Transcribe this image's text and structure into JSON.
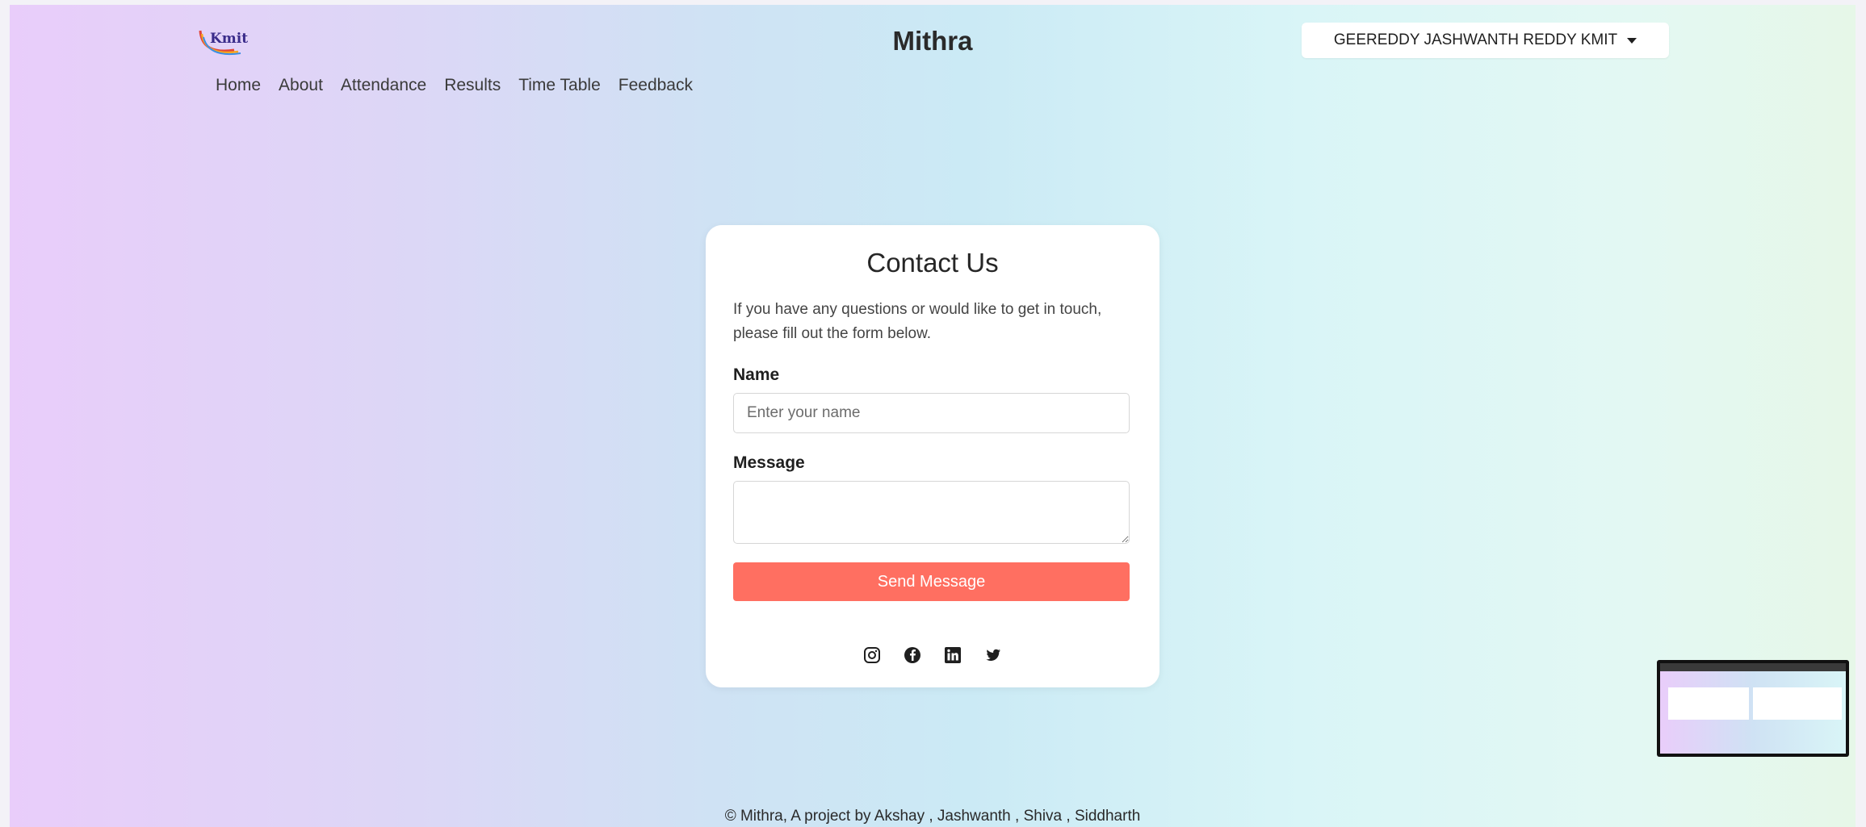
{
  "header": {
    "logo_text": "Kmit",
    "brand_title": "Mithra",
    "user_label": "GEEREDDY JASHWANTH REDDY KMIT"
  },
  "nav": {
    "items": [
      {
        "label": "Home"
      },
      {
        "label": "About"
      },
      {
        "label": "Attendance"
      },
      {
        "label": "Results"
      },
      {
        "label": "Time Table"
      },
      {
        "label": "Feedback"
      }
    ]
  },
  "contact": {
    "title": "Contact Us",
    "description": "If you have any questions or would like to get in touch, please fill out the form below.",
    "name_label": "Name",
    "name_placeholder": "Enter your name",
    "message_label": "Message",
    "send_label": "Send Message"
  },
  "social": {
    "icons": [
      "instagram-icon",
      "facebook-icon",
      "linkedin-icon",
      "twitter-icon"
    ]
  },
  "footer": {
    "text": "© Mithra, A project by Akshay , Jashwanth , Shiva , Siddharth"
  },
  "colors": {
    "accent": "#ff6f61",
    "text_dark": "#262626"
  }
}
